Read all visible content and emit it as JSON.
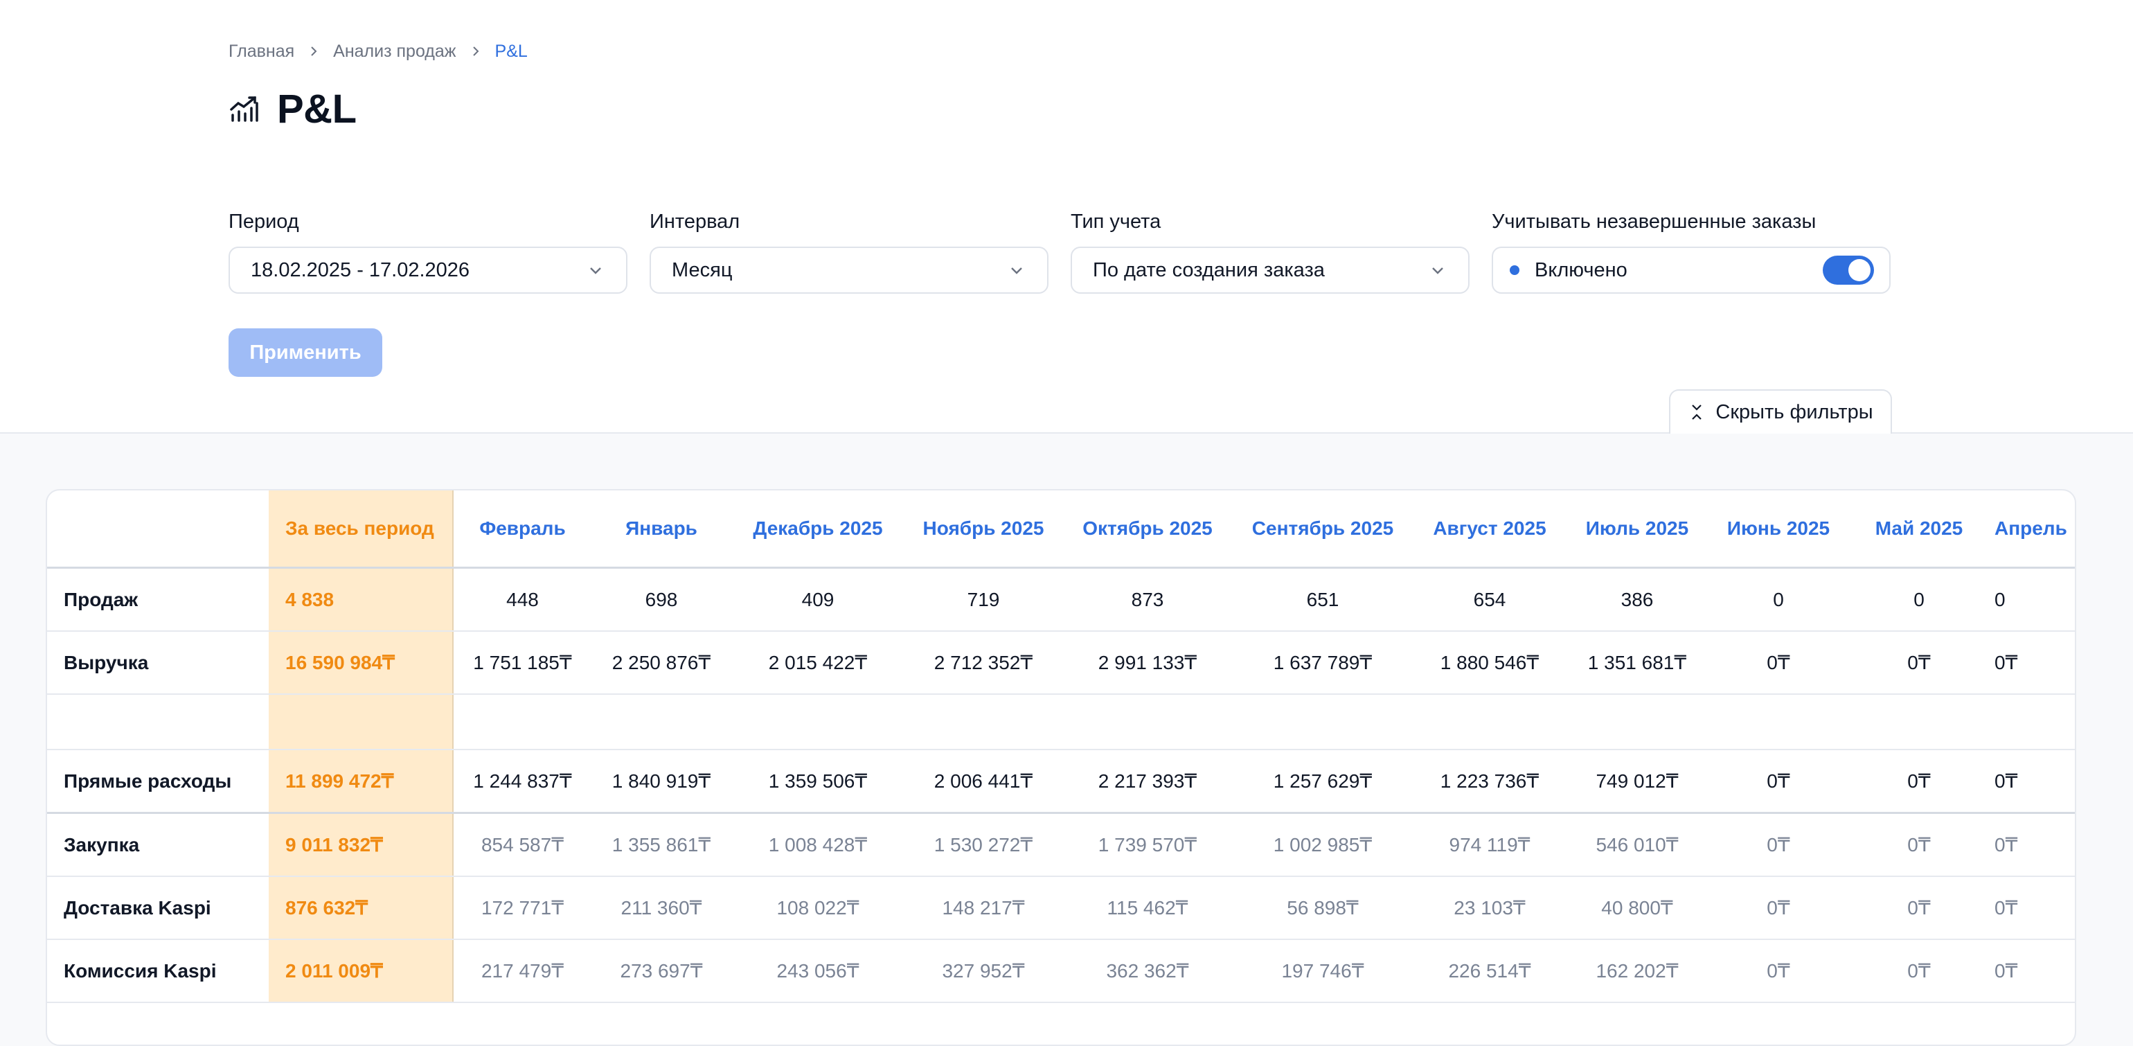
{
  "breadcrumbs": [
    {
      "label": "Главная"
    },
    {
      "label": "Анализ продаж"
    },
    {
      "label": "P&L"
    }
  ],
  "page": {
    "title": "P&L",
    "icon": "trending-chart-icon"
  },
  "filters": {
    "period": {
      "label": "Период",
      "value": "18.02.2025 - 17.02.2026"
    },
    "interval": {
      "label": "Интервал",
      "value": "Месяц"
    },
    "accounting": {
      "label": "Тип учета",
      "value": "По дате создания заказа"
    },
    "incomplete": {
      "label": "Учитывать незавершенные заказы",
      "value": "Включено",
      "enabled": true
    }
  },
  "buttons": {
    "apply": "Применить",
    "hide_filters": "Скрыть фильтры"
  },
  "colors": {
    "accent": "#2f6fde",
    "period_bg": "#ffebcc",
    "period_text": "#f08a12"
  },
  "table": {
    "columns": [
      "",
      "За весь период",
      "Февраль",
      "Январь",
      "Декабрь 2025",
      "Ноябрь 2025",
      "Октябрь 2025",
      "Сентябрь 2025",
      "Август 2025",
      "Июль 2025",
      "Июнь 2025",
      "Май 2025",
      "Апрель"
    ],
    "rows": [
      {
        "label": "Продаж",
        "style": "normal",
        "values": [
          "4 838",
          "448",
          "698",
          "409",
          "719",
          "873",
          "651",
          "654",
          "386",
          "0",
          "0",
          "0"
        ]
      },
      {
        "label": "Выручка",
        "style": "normal",
        "values": [
          "16 590 984₸",
          "1 751 185₸",
          "2 250 876₸",
          "2 015 422₸",
          "2 712 352₸",
          "2 991 133₸",
          "1 637 789₸",
          "1 880 546₸",
          "1 351 681₸",
          "0₸",
          "0₸",
          "0₸"
        ]
      },
      {
        "label": "",
        "style": "spacer",
        "values": [
          "",
          "",
          "",
          "",
          "",
          "",
          "",
          "",
          "",
          "",
          "",
          ""
        ]
      },
      {
        "label": "Прямые расходы",
        "style": "strong",
        "values": [
          "11 899 472₸",
          "1 244 837₸",
          "1 840 919₸",
          "1 359 506₸",
          "2 006 441₸",
          "2 217 393₸",
          "1 257 629₸",
          "1 223 736₸",
          "749 012₸",
          "0₸",
          "0₸",
          "0₸"
        ]
      },
      {
        "label": "Закупка",
        "style": "muted",
        "values": [
          "9 011 832₸",
          "854 587₸",
          "1 355 861₸",
          "1 008 428₸",
          "1 530 272₸",
          "1 739 570₸",
          "1 002 985₸",
          "974 119₸",
          "546 010₸",
          "0₸",
          "0₸",
          "0₸"
        ]
      },
      {
        "label": "Доставка Kaspi",
        "style": "muted",
        "values": [
          "876 632₸",
          "172 771₸",
          "211 360₸",
          "108 022₸",
          "148 217₸",
          "115 462₸",
          "56 898₸",
          "23 103₸",
          "40 800₸",
          "0₸",
          "0₸",
          "0₸"
        ]
      },
      {
        "label": "Комиссия Kaspi",
        "style": "muted",
        "values": [
          "2 011 009₸",
          "217 479₸",
          "273 697₸",
          "243 056₸",
          "327 952₸",
          "362 362₸",
          "197 746₸",
          "226 514₸",
          "162 202₸",
          "0₸",
          "0₸",
          "0₸"
        ]
      }
    ]
  }
}
